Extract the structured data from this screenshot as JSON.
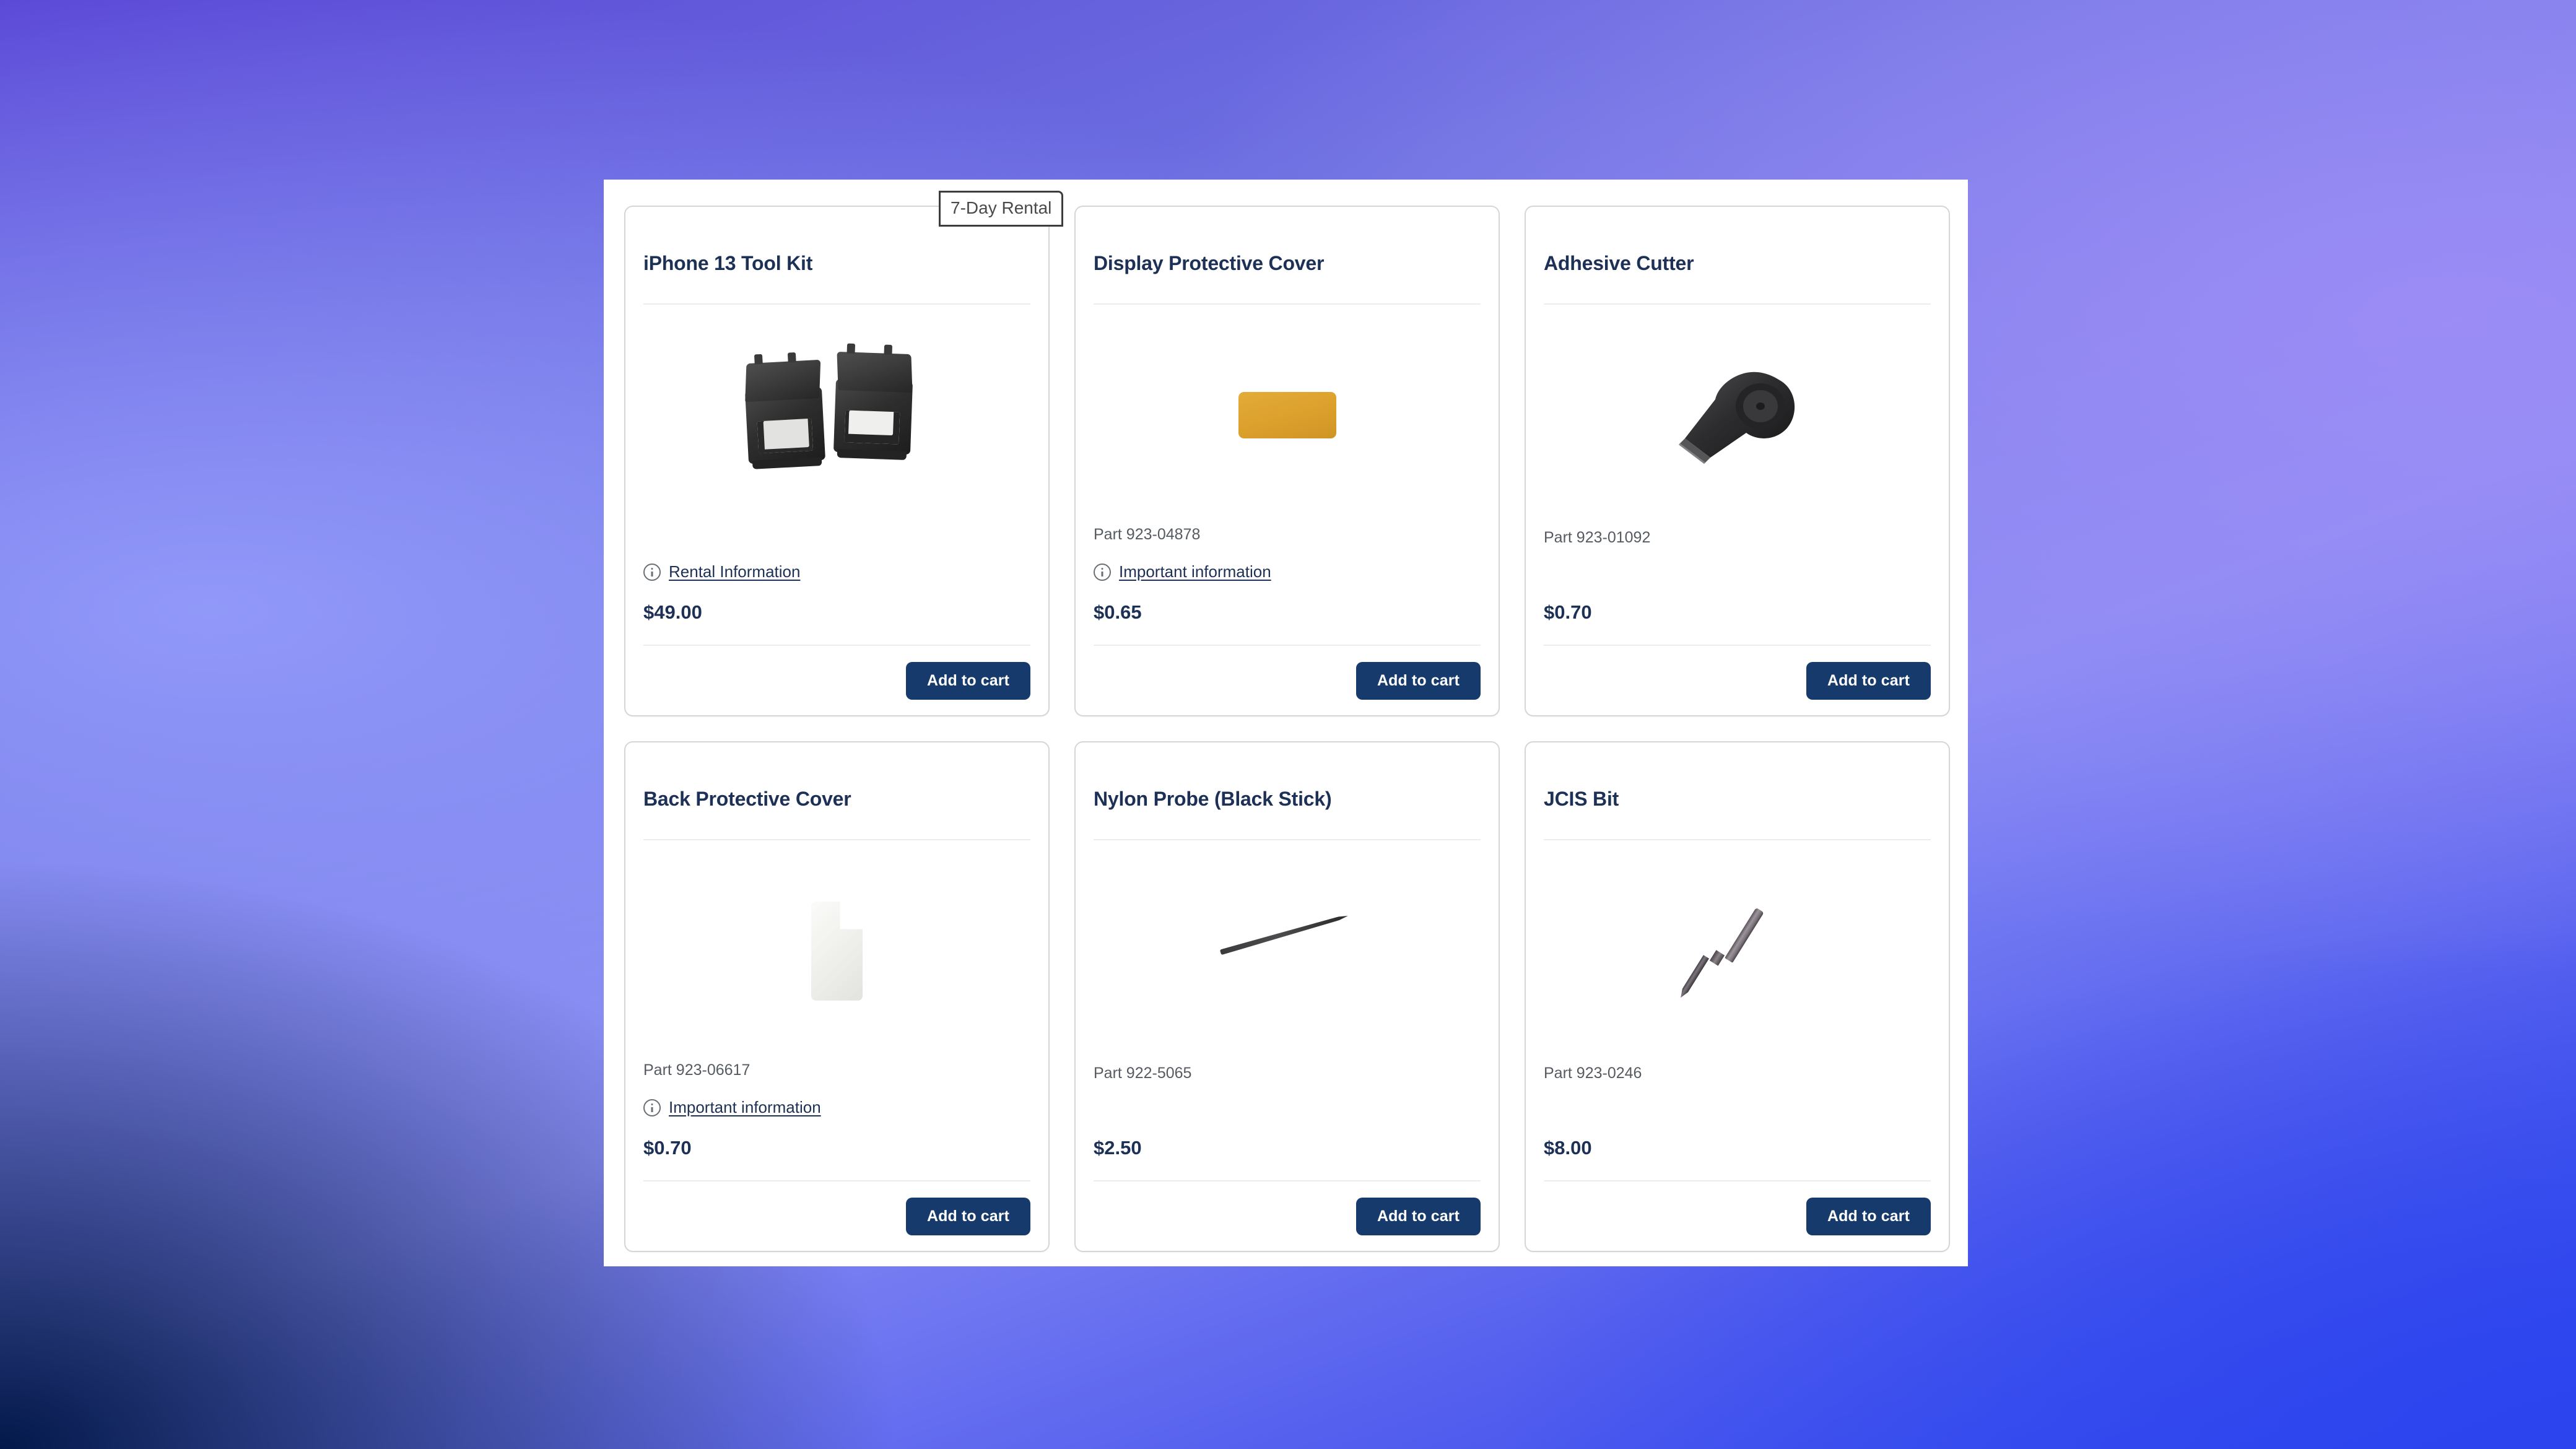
{
  "badge": {
    "label": "7-Day Rental"
  },
  "labels": {
    "add_to_cart": "Add to cart"
  },
  "colors": {
    "accent": "#153a6b",
    "title": "#1d3055",
    "meta": "#555b61",
    "card_border": "#d6d6d6",
    "amber_product": "#dba02c"
  },
  "products": [
    {
      "name": "iPhone 13 Tool Kit",
      "part": "",
      "info_link": "Rental Information",
      "price": "$49.00",
      "button": "Add to cart",
      "art": "toolkit"
    },
    {
      "name": "Display Protective Cover",
      "part": "Part 923-04878",
      "info_link": "Important information",
      "price": "$0.65",
      "button": "Add to cart",
      "art": "amber-cover"
    },
    {
      "name": "Adhesive Cutter",
      "part": "Part 923-01092",
      "info_link": "",
      "price": "$0.70",
      "button": "Add to cart",
      "art": "adhesive-cutter"
    },
    {
      "name": "Back Protective Cover",
      "part": "Part 923-06617",
      "info_link": "Important information",
      "price": "$0.70",
      "button": "Add to cart",
      "art": "back-cover"
    },
    {
      "name": "Nylon Probe (Black Stick)",
      "part": "Part 922-5065",
      "info_link": "",
      "price": "$2.50",
      "button": "Add to cart",
      "art": "probe"
    },
    {
      "name": "JCIS Bit",
      "part": "Part 923-0246",
      "info_link": "",
      "price": "$8.00",
      "button": "Add to cart",
      "art": "bit"
    }
  ]
}
